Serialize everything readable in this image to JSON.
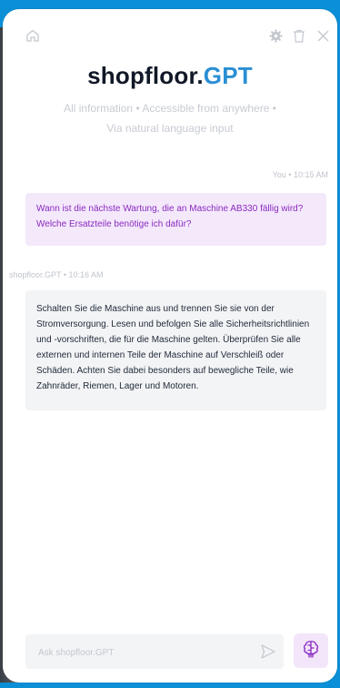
{
  "app": {
    "title_main": "shopfloor.",
    "title_accent": "GPT"
  },
  "subtitle": {
    "line1": "All information  •  Accessible from anywhere  •",
    "line2": "Via natural language input"
  },
  "messages": [
    {
      "sender_meta": "You • 10:15 AM",
      "text": "Wann ist die nächste Wartung, die an Maschine AB330 fällig wird? Welche Ersatzteile benötige ich dafür?"
    },
    {
      "sender_meta": "shopfloor.GPT • 10:16 AM",
      "text": "Schalten Sie die Maschine aus und trennen Sie sie von der Stromversorgung. Lesen und befolgen Sie alle Sicherheitsrichtlinien und -vorschriften, die für die Maschine gelten. Überprüfen Sie alle externen und internen Teile der Maschine auf Verschleiß oder Schäden. Achten Sie dabei besonders auf bewegliche Teile, wie Zahnräder, Riemen, Lager und Motoren."
    }
  ],
  "input": {
    "placeholder": "Ask shopfloor.GPT",
    "value": ""
  },
  "icons": {
    "home": "home-icon",
    "settings": "gear-icon",
    "delete": "trash-icon",
    "close": "close-icon",
    "send": "send-icon",
    "brain": "brain-icon"
  },
  "colors": {
    "accent": "#2a8fd4",
    "user_bubble_bg": "#f4e8fb",
    "user_text": "#8a2ac0",
    "bot_bubble_bg": "#f3f4f6",
    "frame": "#0b8fd6"
  }
}
